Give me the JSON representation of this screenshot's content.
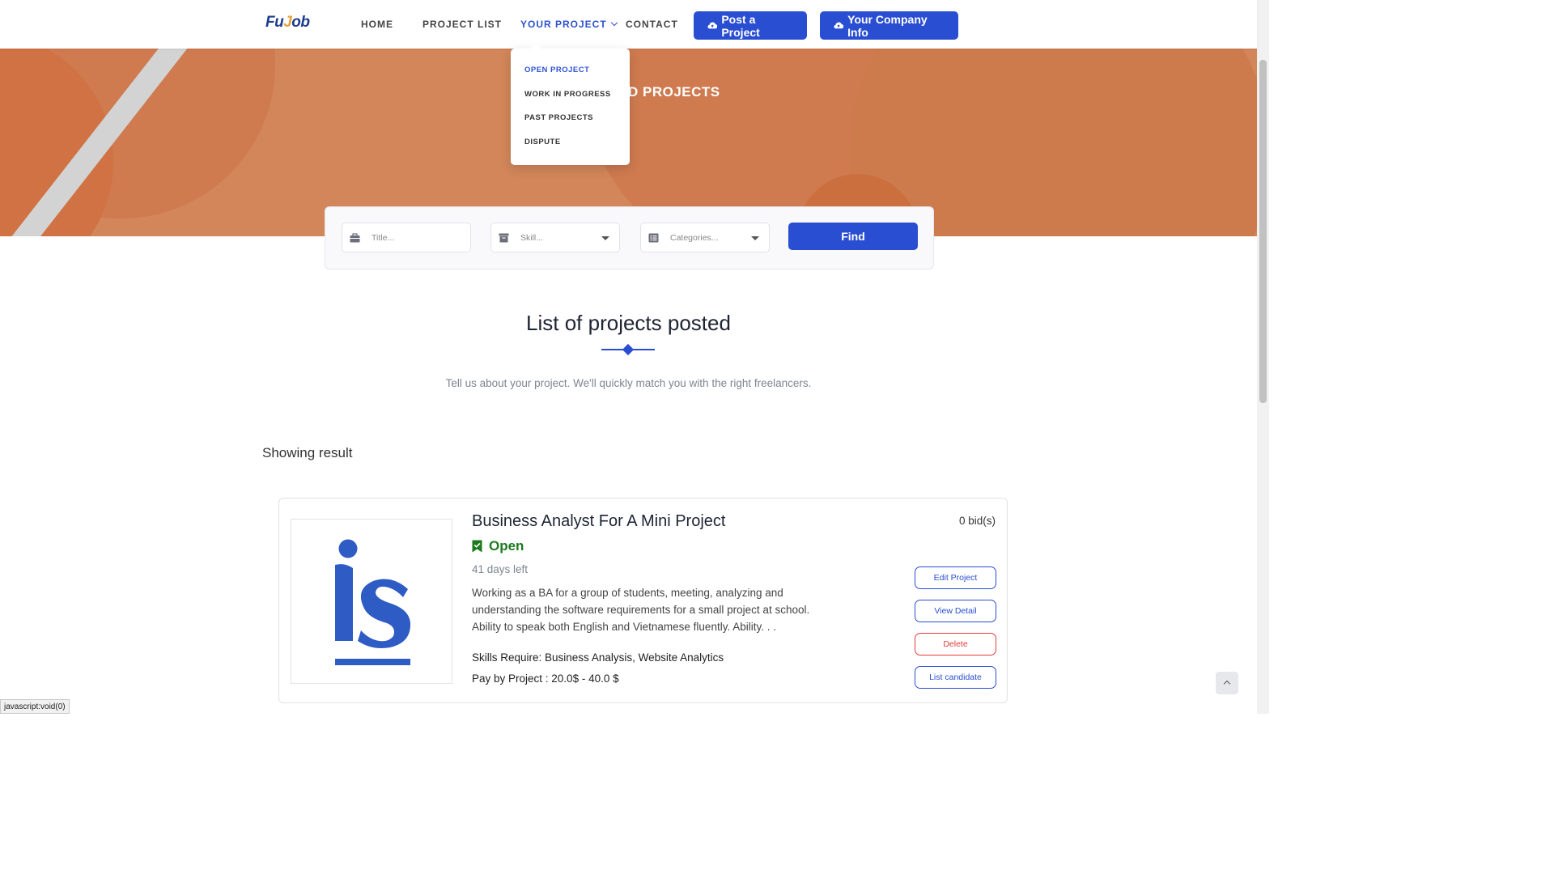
{
  "header": {
    "logo_text_a": "Fu",
    "logo_text_b": "J",
    "logo_text_c": "ob",
    "nav": {
      "home": "HOME",
      "project_list": "PROJECT LIST",
      "your_project": "YOUR PROJECT",
      "contact": "CONTACT"
    },
    "post_project_label": "Post a Project",
    "company_info_label": "Your Company Info"
  },
  "dropdown": {
    "items": [
      "OPEN PROJECT",
      "WORK IN PROGRESS",
      "PAST PROJECTS",
      "DISPUTE"
    ],
    "active_index": 0
  },
  "hero": {
    "title_visible": "D PROJECTS"
  },
  "search": {
    "title_placeholder": "Title...",
    "skill_placeholder": "Skill...",
    "categories_placeholder": "Categories...",
    "find_label": "Find"
  },
  "section": {
    "title": "List of projects posted",
    "subtitle": "Tell us about your project. We'll quickly match you with the right freelancers.",
    "showing_label": "Showing result"
  },
  "project": {
    "title": "Business Analyst For A Mini Project",
    "status": "Open",
    "time_left": "41 days left",
    "description": "Working as a BA for a group of students, meeting, analyzing and understanding the software requirements for a small project at school. Ability to speak both English and Vietnamese fluently. Ability. . .",
    "skills": "Skills Require: Business Analysis, Website Analytics",
    "pay": "Pay by Project : 20.0$ - 40.0 $",
    "bids": "0 bid(s)",
    "actions": {
      "edit": "Edit Project",
      "view": "View Detail",
      "delete": "Delete",
      "candidates": "List candidate"
    }
  },
  "statusbar_url": "javascript:void(0)",
  "colors": {
    "primary": "#2a4ed1",
    "hero": "#d2865a",
    "danger": "#e33b3b",
    "success": "#1e7a1e"
  }
}
